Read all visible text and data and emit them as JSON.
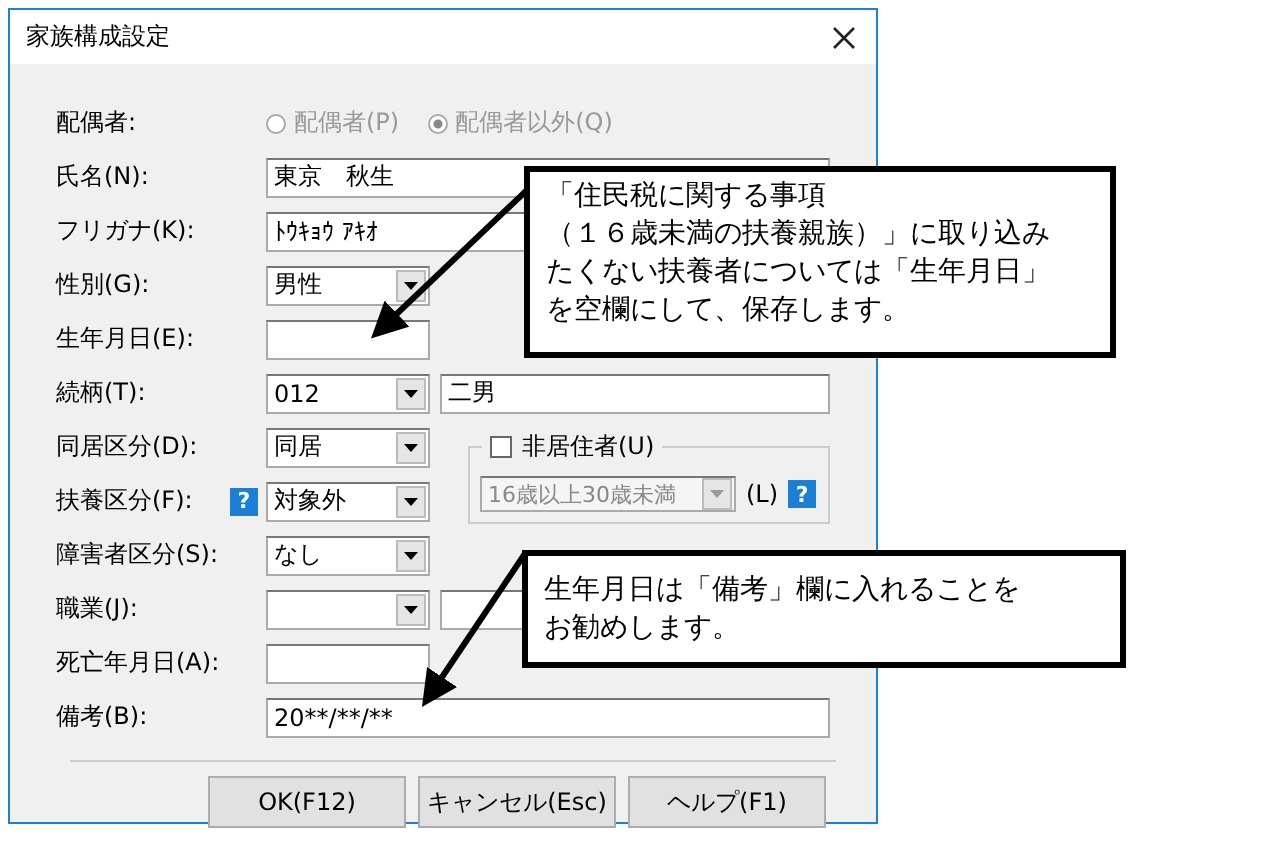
{
  "window": {
    "title": "家族構成設定"
  },
  "spouse": {
    "label": "配偶者:",
    "disabled": true,
    "options": [
      {
        "label": "配偶者(P)",
        "selected": false
      },
      {
        "label": "配偶者以外(Q)",
        "selected": true
      }
    ]
  },
  "rows": [
    {
      "kind": "text",
      "label": "氏名(N):",
      "value": "東京　秋生"
    },
    {
      "kind": "text",
      "label": "フリガナ(K):",
      "value": "ﾄｳｷｮｳ ｱｷｵ"
    },
    {
      "kind": "combo",
      "label": "性別(G):",
      "value": "男性"
    },
    {
      "kind": "short",
      "label": "生年月日(E):"
    },
    {
      "kind": "combo_text",
      "label": "続柄(T):",
      "value": "012",
      "extra": "二男"
    },
    {
      "kind": "combo",
      "label": "同居区分(D):",
      "value": "同居"
    },
    {
      "kind": "combo",
      "label": "扶養区分(F):",
      "value": "対象外",
      "help": "?"
    },
    {
      "kind": "combo",
      "label": "障害者区分(S):",
      "value": "なし"
    },
    {
      "kind": "combo_text",
      "label": "職業(J):"
    },
    {
      "kind": "short",
      "label": "死亡年月日(A):"
    },
    {
      "kind": "text",
      "label": "備考(B):",
      "value": "20**/**/**"
    }
  ],
  "nonresident": {
    "label": "非居住者(U)",
    "checked": false,
    "combo_value": "16歳以上30歳未満",
    "disabled": true,
    "suffix": "(L)",
    "help": "?"
  },
  "buttons": [
    "OK(F12)",
    "キャンセル(Esc)",
    "ヘルプ(F1)"
  ],
  "callouts": [
    {
      "lines": [
        "「住民税に関する事項",
        "（１６歳未満の扶養親族）」に取り込み",
        "たくない扶養者については「生年月日」",
        "を空欄にして、保存します。"
      ]
    },
    {
      "lines": [
        "生年月日は「備考」欄に入れることを",
        "お勧めします。"
      ]
    }
  ]
}
